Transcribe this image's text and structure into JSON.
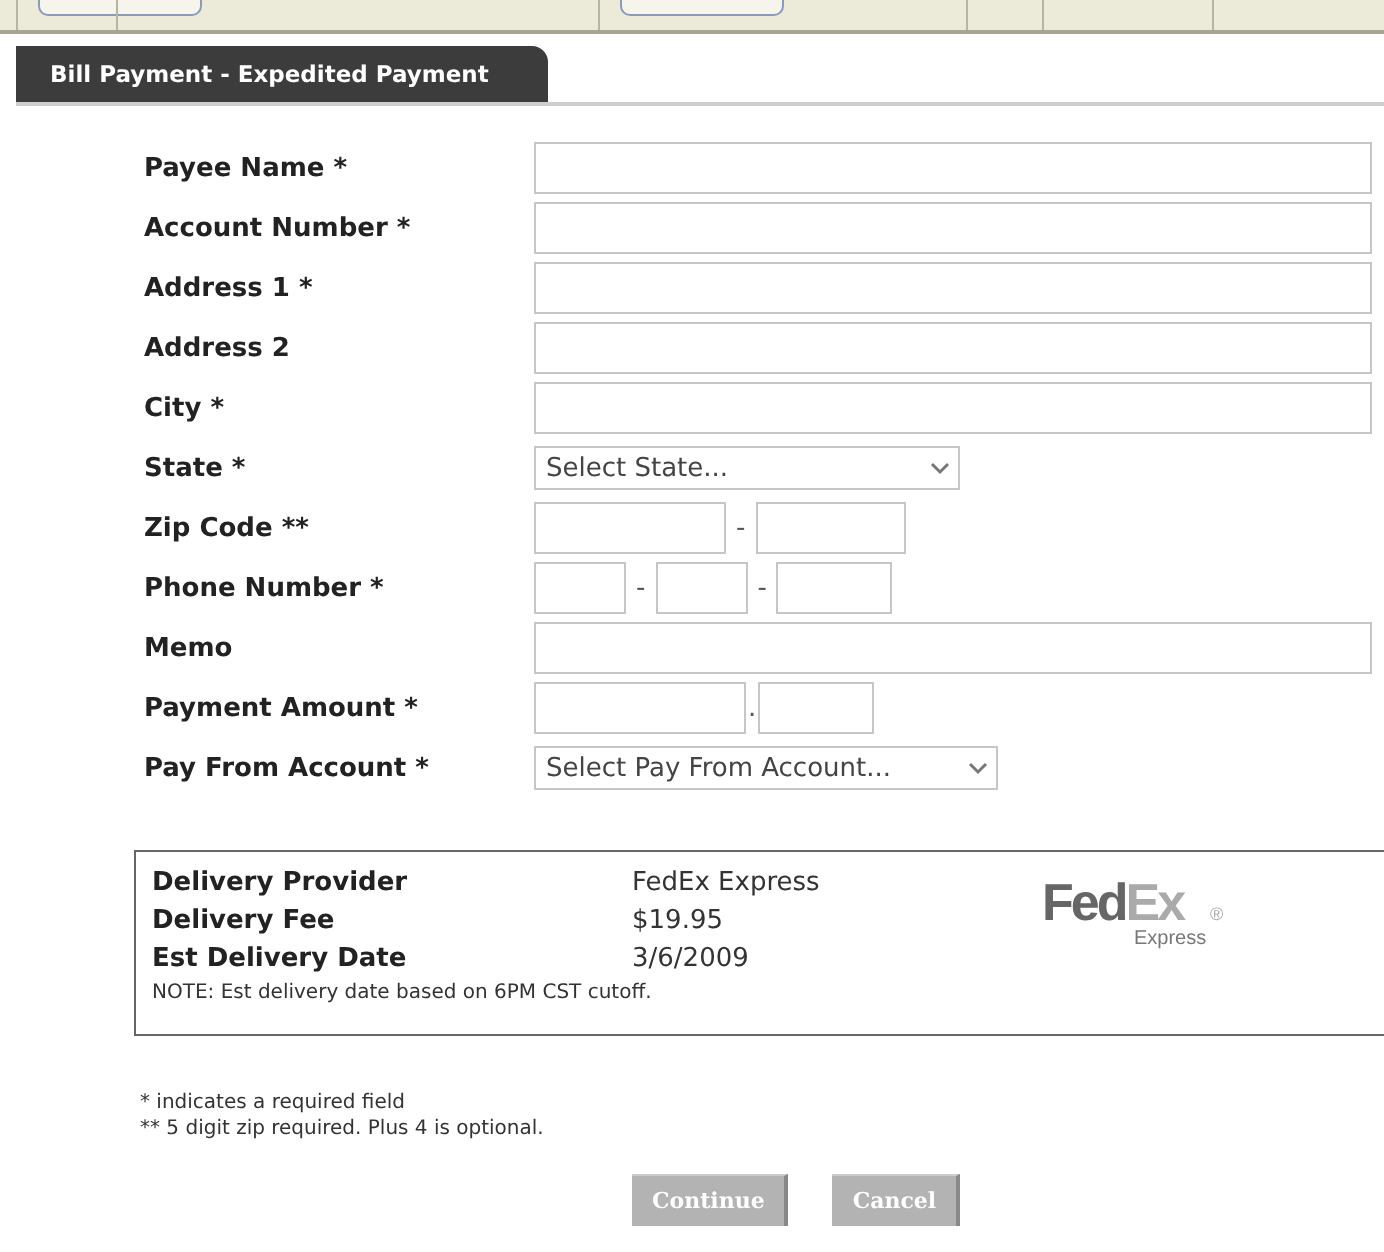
{
  "tab": {
    "label": "Bill Payment - Expedited Payment",
    "selected": true
  },
  "fields": [
    {
      "label": "Payee Name *",
      "kind": "text"
    },
    {
      "label": "Account Number *",
      "kind": "text"
    },
    {
      "label": "Address 1 *",
      "kind": "text"
    },
    {
      "label": "Address 2",
      "kind": "text"
    },
    {
      "label": "City *",
      "kind": "text"
    },
    {
      "label": "State *",
      "kind": "select",
      "value": "Select State..."
    },
    {
      "label": "Zip Code **",
      "kind": "split",
      "separators": [
        "-"
      ]
    },
    {
      "label": "Phone Number *",
      "kind": "split",
      "separators": [
        "-",
        "-"
      ]
    },
    {
      "label": "Memo",
      "kind": "text"
    },
    {
      "label": "Payment Amount *",
      "kind": "split",
      "separators": [
        "."
      ]
    },
    {
      "label": "Pay From Account *",
      "kind": "select",
      "value": "Select Pay From Account..."
    }
  ],
  "delivery": {
    "rows": [
      {
        "label": "Delivery Provider",
        "value": "FedEx Express"
      },
      {
        "label": "Delivery Fee",
        "value": "$19.95"
      },
      {
        "label": "Est Delivery Date",
        "value": "3/6/2009"
      }
    ],
    "note": "NOTE: Est delivery date based on 6PM CST cutoff.",
    "logo": {
      "part_1": "Fed",
      "part_2": "Ex",
      "mark": "®",
      "sub": "Express"
    }
  },
  "notes": [
    "* indicates a required field",
    "** 5 digit zip required. Plus 4 is optional."
  ],
  "buttons": [
    "Continue",
    "Cancel"
  ]
}
